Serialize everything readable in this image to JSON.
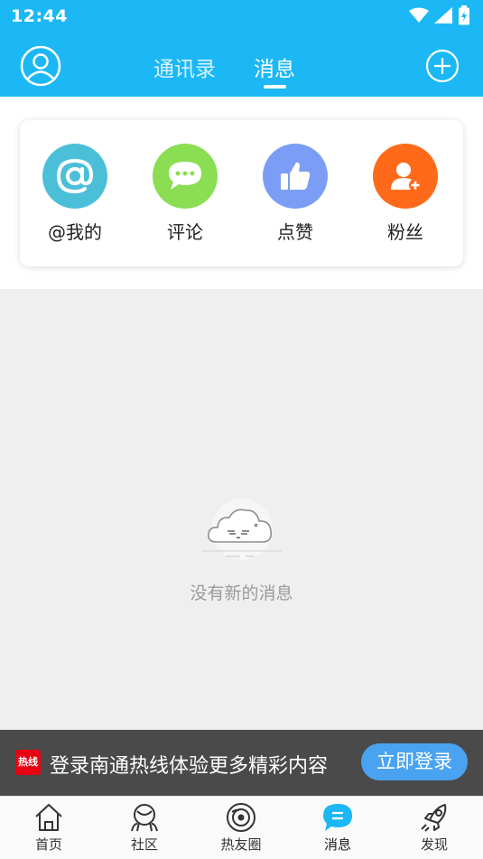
{
  "status_bar": {
    "time": "12:44"
  },
  "header": {
    "tabs": [
      {
        "label": "通讯录",
        "active": false
      },
      {
        "label": "消息",
        "active": true
      }
    ]
  },
  "categories": [
    {
      "label": "@我的",
      "icon": "at-icon",
      "color": "#4cbfd8"
    },
    {
      "label": "评论",
      "icon": "comment-icon",
      "color": "#8bdd52"
    },
    {
      "label": "点赞",
      "icon": "thumbs-up-icon",
      "color": "#7b9df5"
    },
    {
      "label": "粉丝",
      "icon": "add-user-icon",
      "color": "#ff6a1a"
    }
  ],
  "empty_state": {
    "message": "没有新的消息"
  },
  "login_banner": {
    "logo_text": "热线",
    "text": "登录南通热线体验更多精彩内容",
    "button_label": "立即登录"
  },
  "bottom_nav": {
    "items": [
      {
        "label": "首页",
        "icon": "home-icon",
        "active": false
      },
      {
        "label": "社区",
        "icon": "community-icon",
        "active": false
      },
      {
        "label": "热友圈",
        "icon": "friends-circle-icon",
        "active": false
      },
      {
        "label": "消息",
        "icon": "message-icon",
        "active": true
      },
      {
        "label": "发现",
        "icon": "rocket-icon",
        "active": false
      }
    ]
  },
  "colors": {
    "primary": "#1bb8f5",
    "banner_bg": "#4a4a4a",
    "banner_button": "#4aa3f0"
  }
}
